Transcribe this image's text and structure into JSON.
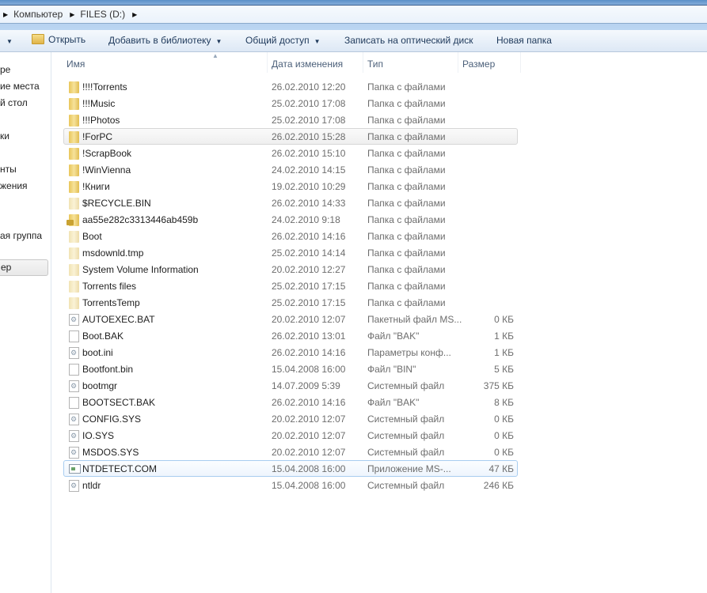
{
  "address": {
    "crumbs": [
      "Компьютер",
      "FILES (D:)"
    ]
  },
  "toolbar": {
    "open": "Открыть",
    "add_library": "Добавить в библиотеку",
    "share": "Общий доступ",
    "burn": "Записать на оптический диск",
    "new_folder": "Новая папка"
  },
  "sidebar": [
    "ре",
    "ие места",
    "й стол",
    "ки",
    "нты",
    "жения",
    "ая группа",
    "ер"
  ],
  "columns": {
    "name": "Имя",
    "date": "Дата изменения",
    "type": "Тип",
    "size": "Размер"
  },
  "files": [
    {
      "name": "!!!!Torrents",
      "date": "26.02.2010 12:20",
      "type": "Папка с файлами",
      "size": "",
      "icon": "folder"
    },
    {
      "name": "!!!Music",
      "date": "25.02.2010 17:08",
      "type": "Папка с файлами",
      "size": "",
      "icon": "folder"
    },
    {
      "name": "!!!Photos",
      "date": "25.02.2010 17:08",
      "type": "Папка с файлами",
      "size": "",
      "icon": "folder"
    },
    {
      "name": "!ForPC",
      "date": "26.02.2010 15:28",
      "type": "Папка с файлами",
      "size": "",
      "icon": "folder"
    },
    {
      "name": "!ScrapBook",
      "date": "26.02.2010 15:10",
      "type": "Папка с файлами",
      "size": "",
      "icon": "folder"
    },
    {
      "name": "!WinVienna",
      "date": "24.02.2010 14:15",
      "type": "Папка с файлами",
      "size": "",
      "icon": "folder"
    },
    {
      "name": "!Книги",
      "date": "19.02.2010 10:29",
      "type": "Папка с файлами",
      "size": "",
      "icon": "folder"
    },
    {
      "name": "$RECYCLE.BIN",
      "date": "26.02.2010 14:33",
      "type": "Папка с файлами",
      "size": "",
      "icon": "folder-hidden"
    },
    {
      "name": "aa55e282c3313446ab459b",
      "date": "24.02.2010 9:18",
      "type": "Папка с файлами",
      "size": "",
      "icon": "folder-locked"
    },
    {
      "name": "Boot",
      "date": "26.02.2010 14:16",
      "type": "Папка с файлами",
      "size": "",
      "icon": "folder-hidden"
    },
    {
      "name": "msdownld.tmp",
      "date": "25.02.2010 14:14",
      "type": "Папка с файлами",
      "size": "",
      "icon": "folder-hidden"
    },
    {
      "name": "System Volume Information",
      "date": "20.02.2010 12:27",
      "type": "Папка с файлами",
      "size": "",
      "icon": "folder-hidden"
    },
    {
      "name": "Torrents files",
      "date": "25.02.2010 17:15",
      "type": "Папка с файлами",
      "size": "",
      "icon": "folder-hidden"
    },
    {
      "name": "TorrentsTemp",
      "date": "25.02.2010 17:15",
      "type": "Папка с файлами",
      "size": "",
      "icon": "folder-hidden"
    },
    {
      "name": "AUTOEXEC.BAT",
      "date": "20.02.2010 12:07",
      "type": "Пакетный файл MS...",
      "size": "0 КБ",
      "icon": "system-file"
    },
    {
      "name": "Boot.BAK",
      "date": "26.02.2010 13:01",
      "type": "Файл \"BAK\"",
      "size": "1 КБ",
      "icon": "file"
    },
    {
      "name": "boot.ini",
      "date": "26.02.2010 14:16",
      "type": "Параметры конф...",
      "size": "1 КБ",
      "icon": "system-file"
    },
    {
      "name": "Bootfont.bin",
      "date": "15.04.2008 16:00",
      "type": "Файл \"BIN\"",
      "size": "5 КБ",
      "icon": "file"
    },
    {
      "name": "bootmgr",
      "date": "14.07.2009 5:39",
      "type": "Системный файл",
      "size": "375 КБ",
      "icon": "system-file"
    },
    {
      "name": "BOOTSECT.BAK",
      "date": "26.02.2010 14:16",
      "type": "Файл \"BAK\"",
      "size": "8 КБ",
      "icon": "file"
    },
    {
      "name": "CONFIG.SYS",
      "date": "20.02.2010 12:07",
      "type": "Системный файл",
      "size": "0 КБ",
      "icon": "system-file"
    },
    {
      "name": "IO.SYS",
      "date": "20.02.2010 12:07",
      "type": "Системный файл",
      "size": "0 КБ",
      "icon": "system-file"
    },
    {
      "name": "MSDOS.SYS",
      "date": "20.02.2010 12:07",
      "type": "Системный файл",
      "size": "0 КБ",
      "icon": "system-file"
    },
    {
      "name": "NTDETECT.COM",
      "date": "15.04.2008 16:00",
      "type": "Приложение MS-...",
      "size": "47 КБ",
      "icon": "application"
    },
    {
      "name": "ntldr",
      "date": "15.04.2008 16:00",
      "type": "Системный файл",
      "size": "246 КБ",
      "icon": "system-file"
    }
  ]
}
